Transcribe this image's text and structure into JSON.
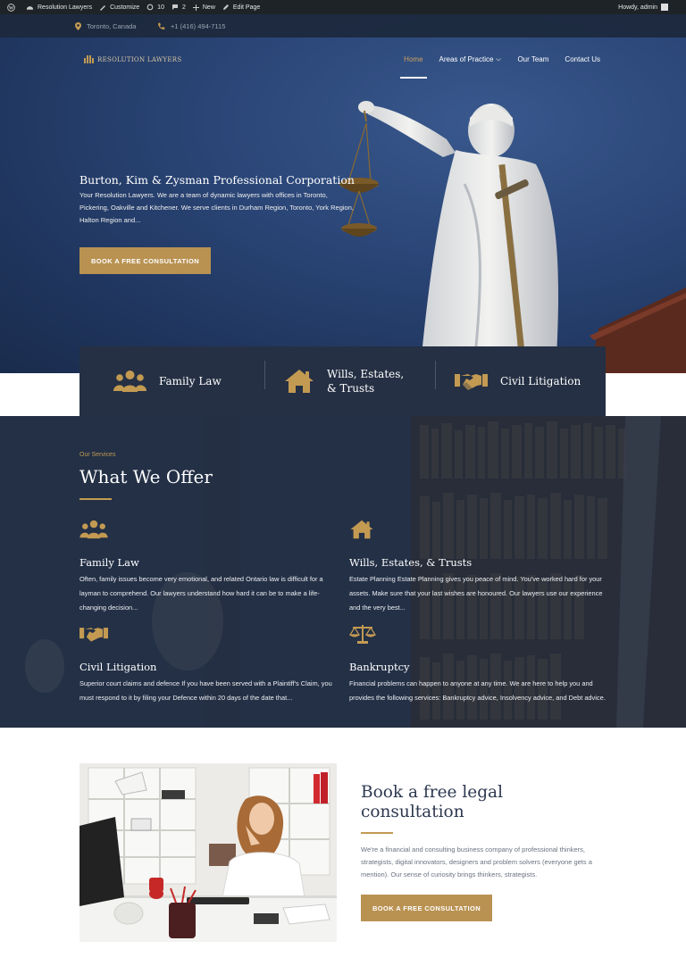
{
  "admin_bar": {
    "site_name": "Resolution Lawyers",
    "customize": "Customize",
    "updates": "10",
    "comments": "2",
    "new": "New",
    "edit_page": "Edit Page",
    "greeting": "Howdy, admin"
  },
  "topbar": {
    "location": "Toronto, Canada",
    "phone": "+1 (416) 494-7115"
  },
  "logo": {
    "text": "RESOLUTION LAWYERS"
  },
  "nav": {
    "items": [
      "Home",
      "Areas of Practice",
      "Our Team",
      "Contact Us"
    ],
    "active": "Home"
  },
  "hero": {
    "title": "Burton, Kim & Zysman Professional Corporation",
    "text": "Your Resolution Lawyers. We are a team of dynamic lawyers with offices in Toronto, Pickering, Oakville and Kitchener. We serve clients in Durham Region, Toronto, York Region, Halton Region and...",
    "button": "BOOK A FREE CONSULTATION"
  },
  "strip": {
    "items": [
      {
        "label": "Family Law",
        "icon": "family-icon"
      },
      {
        "label": "Wills, Estates, & Trusts",
        "icon": "house-icon"
      },
      {
        "label": "Civil Litigation",
        "icon": "handshake-icon"
      }
    ]
  },
  "services": {
    "kicker": "Our Services",
    "title": "What We Offer",
    "items": [
      {
        "title": "Family Law",
        "text": "Often, family issues become very emotional, and related Ontario law is difficult for a layman to comprehend. Our lawyers understand how hard it can be to make a life-changing decision...",
        "icon": "family-icon"
      },
      {
        "title": "Wills, Estates, & Trusts",
        "text": "Estate Planning Estate Planning gives you peace of mind. You've worked hard for your assets. Make sure that your last wishes are honoured. Our lawyers use our experience and the very best...",
        "icon": "house-icon"
      },
      {
        "title": "Civil Litigation",
        "text": "Superior court claims and defence If you have been served with a Plaintiff's Claim, you must respond to it by filing your Defence within 20 days of the date that...",
        "icon": "handshake-icon"
      },
      {
        "title": "Bankruptcy",
        "text": "Financial problems can happen to anyone at any time. We are here to help you and provides the following services: Bankruptcy advice, Insolvency advice, and Debt advice.",
        "icon": "scales-icon"
      }
    ]
  },
  "consultation": {
    "title": "Book a free legal consultation",
    "text": "We're a financial and consulting business company of professional thinkers, strategists, digital innovators, designers and problem solvers (everyone gets a mention). Our sense of curiosity brings thinkers, strategists.",
    "button": "BOOK A FREE CONSULTATION"
  },
  "colors": {
    "gold": "#b99252",
    "navy": "#253044",
    "dark": "#1d2327"
  }
}
